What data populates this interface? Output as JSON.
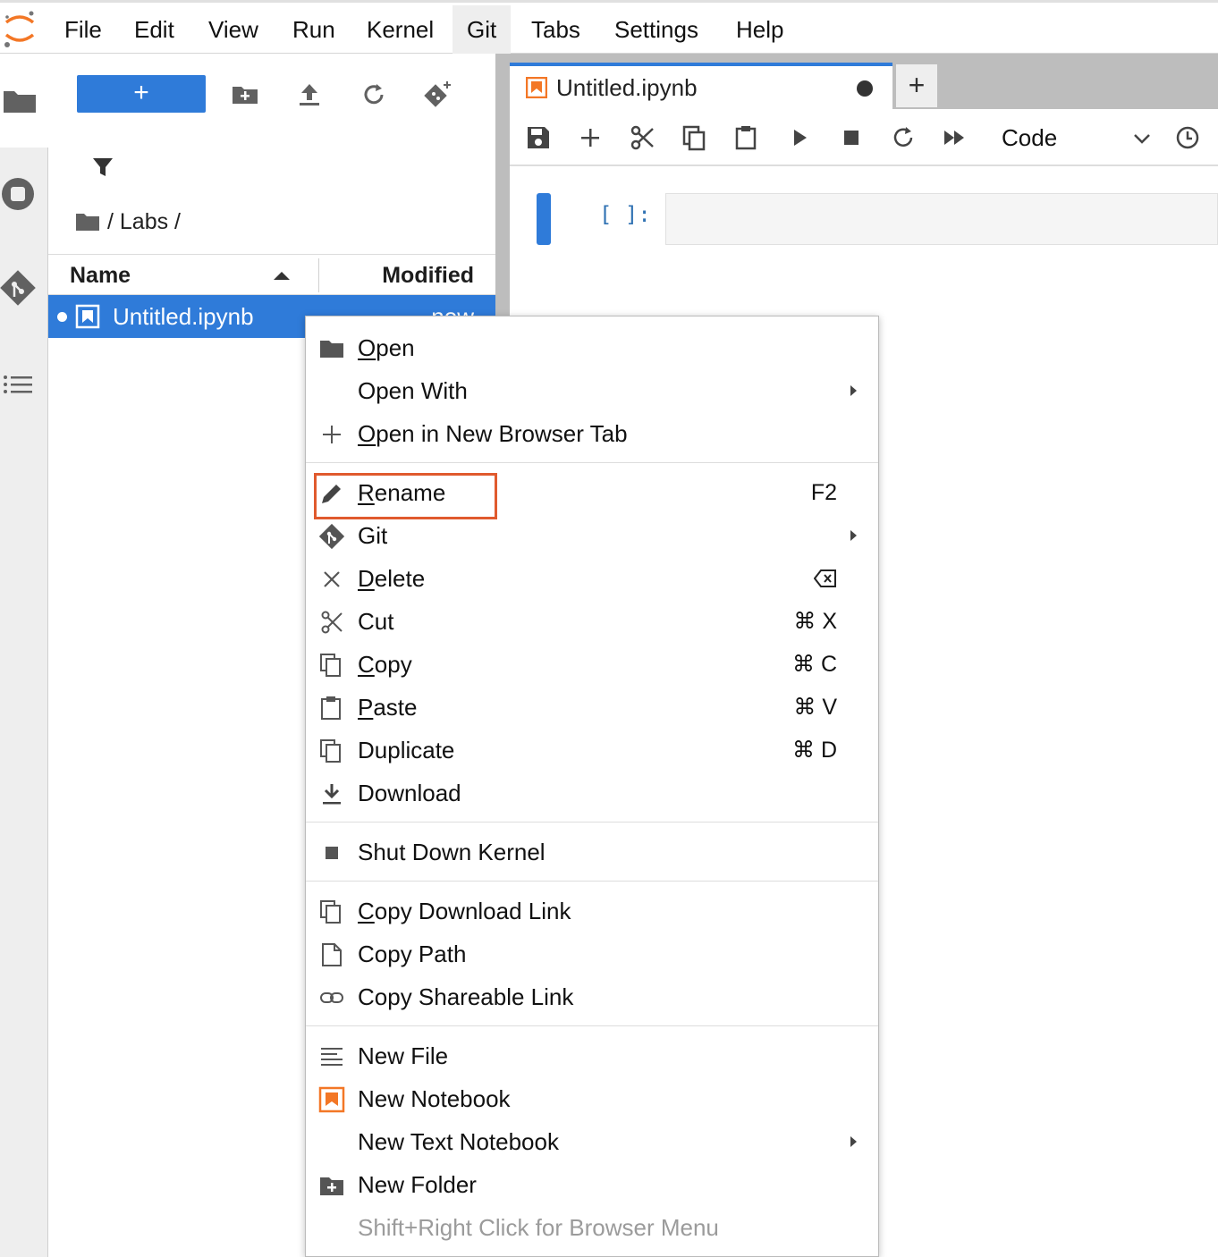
{
  "menubar": {
    "items": [
      "File",
      "Edit",
      "View",
      "Run",
      "Kernel",
      "Git",
      "Tabs",
      "Settings",
      "Help"
    ],
    "active": "Git"
  },
  "browser": {
    "new_button": "+",
    "breadcrumb": "/ Labs /",
    "columns": {
      "name": "Name",
      "modified": "Modified"
    },
    "file": {
      "name": "Untitled.ipynb",
      "modified": "now"
    }
  },
  "notebook": {
    "tab_title": "Untitled.ipynb",
    "tab_add": "+",
    "cell_type": "Code",
    "cell_prompt": "[ ]:"
  },
  "context_menu": {
    "items": [
      {
        "label": "Open",
        "mnemonic": "O",
        "icon": "folder-icon"
      },
      {
        "label": "Open With",
        "icon": "",
        "submenu": true
      },
      {
        "label": "Open in New Browser Tab",
        "mnemonic": "O",
        "icon": "plus-icon"
      },
      {
        "label": "Rename",
        "mnemonic": "R",
        "icon": "pencil-icon",
        "shortcut": "F2",
        "highlighted": true
      },
      {
        "label": "Git",
        "icon": "git-icon",
        "submenu": true
      },
      {
        "label": "Delete",
        "mnemonic": "D",
        "icon": "close-icon",
        "shortcut_icon": "backspace-icon"
      },
      {
        "label": "Cut",
        "icon": "scissors-icon",
        "shortcut": "⌘ X"
      },
      {
        "label": "Copy",
        "mnemonic": "C",
        "icon": "copy-icon",
        "shortcut": "⌘ C"
      },
      {
        "label": "Paste",
        "mnemonic": "P",
        "icon": "clipboard-icon",
        "shortcut": "⌘ V"
      },
      {
        "label": "Duplicate",
        "icon": "copy-icon",
        "shortcut": "⌘ D"
      },
      {
        "label": "Download",
        "icon": "download-icon"
      },
      {
        "label": "Shut Down Kernel",
        "icon": "stop-icon"
      },
      {
        "label": "Copy Download Link",
        "mnemonic": "C",
        "icon": "copy-icon"
      },
      {
        "label": "Copy Path",
        "icon": "file-icon"
      },
      {
        "label": "Copy Shareable Link",
        "icon": "link-icon"
      },
      {
        "label": "New File",
        "icon": "text-file-icon"
      },
      {
        "label": "New Notebook",
        "icon": "notebook-icon"
      },
      {
        "label": "New Text Notebook",
        "icon": "",
        "submenu": true
      },
      {
        "label": "New Folder",
        "icon": "new-folder-icon"
      },
      {
        "label": "Shift+Right Click for Browser Menu",
        "hint": true
      }
    ]
  },
  "colors": {
    "accent": "#2f7bd9",
    "highlight_border": "#e05a2e",
    "jupyter_orange": "#f37726"
  }
}
